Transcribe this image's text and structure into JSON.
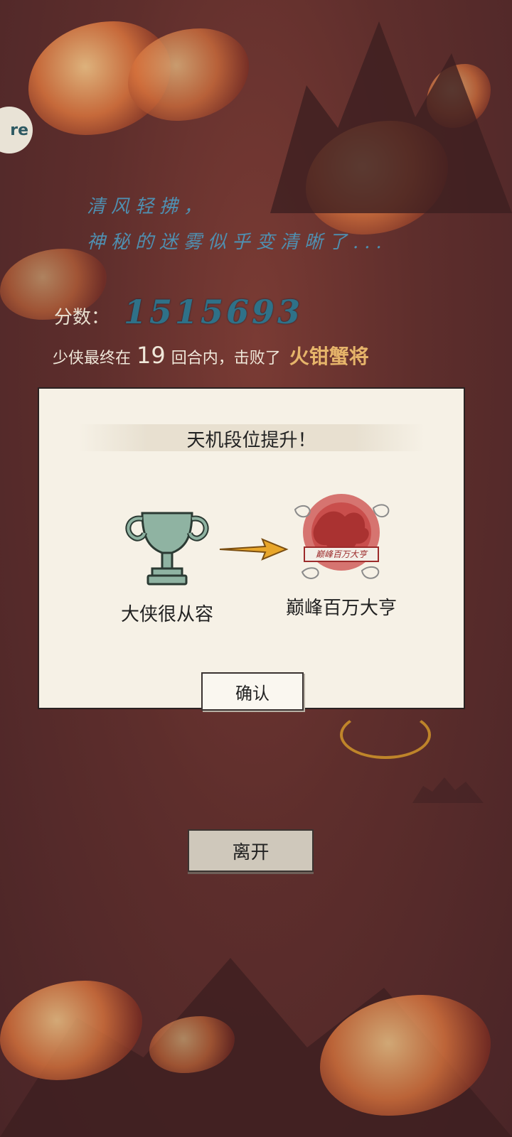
{
  "colors": {
    "background": "#5e2e2c",
    "poem": "#4f8fb0",
    "score": "#2f7188",
    "boss": "#e6b46a",
    "modal_bg": "#f6f1e6",
    "seal_red": "#c84a48",
    "arrow": "#e8a62a"
  },
  "side_badge": {
    "text": "re",
    "icon": "game-badge-icon"
  },
  "poem": {
    "line1": "清风轻拂，",
    "line2": "神秘的迷雾似乎变清晰了..."
  },
  "score": {
    "label": "分数：",
    "value": "1515693"
  },
  "result": {
    "prefix": "少侠最终在",
    "rounds": "19",
    "middle": "回合内，击败了",
    "boss": "火钳蟹将"
  },
  "modal": {
    "title": "天机段位提升！",
    "from_rank": {
      "label": "大侠很从容",
      "icon": "trophy-icon"
    },
    "to_rank": {
      "label": "巅峰百万大亨",
      "icon": "dragon-seal-icon",
      "plate": "巅峰百万大亨"
    },
    "arrow_icon": "arrow-right-icon",
    "confirm_label": "确认"
  },
  "leave_label": "离开"
}
